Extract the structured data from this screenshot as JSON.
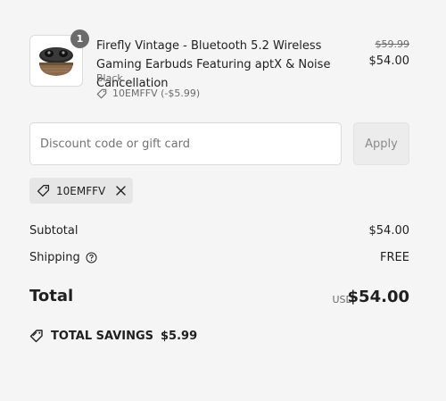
{
  "line_item": {
    "quantity": "1",
    "title": "Firefly Vintage - Bluetooth 5.2 Wireless Gaming Earbuds Featuring aptX & Noise Cancellation",
    "variant": "Black",
    "discount_note": "10EMFFV (-$5.99)",
    "original_price": "$59.99",
    "price": "$54.00",
    "image_icon": "earbuds-icon"
  },
  "discount": {
    "placeholder": "Discount code or gift card",
    "value": "",
    "apply_label": "Apply",
    "applied_code": "10EMFFV"
  },
  "summary": {
    "subtotal_label": "Subtotal",
    "subtotal_value": "$54.00",
    "shipping_label": "Shipping",
    "shipping_value": "FREE",
    "total_label": "Total",
    "total_currency": "USD",
    "total_value": "$54.00",
    "savings_label": "TOTAL SAVINGS",
    "savings_value": "$5.99"
  },
  "colors": {
    "background": "#f5f5f5",
    "text": "#1f1f1f",
    "muted": "#6b6b6b",
    "badge": "#6b6b6b"
  }
}
